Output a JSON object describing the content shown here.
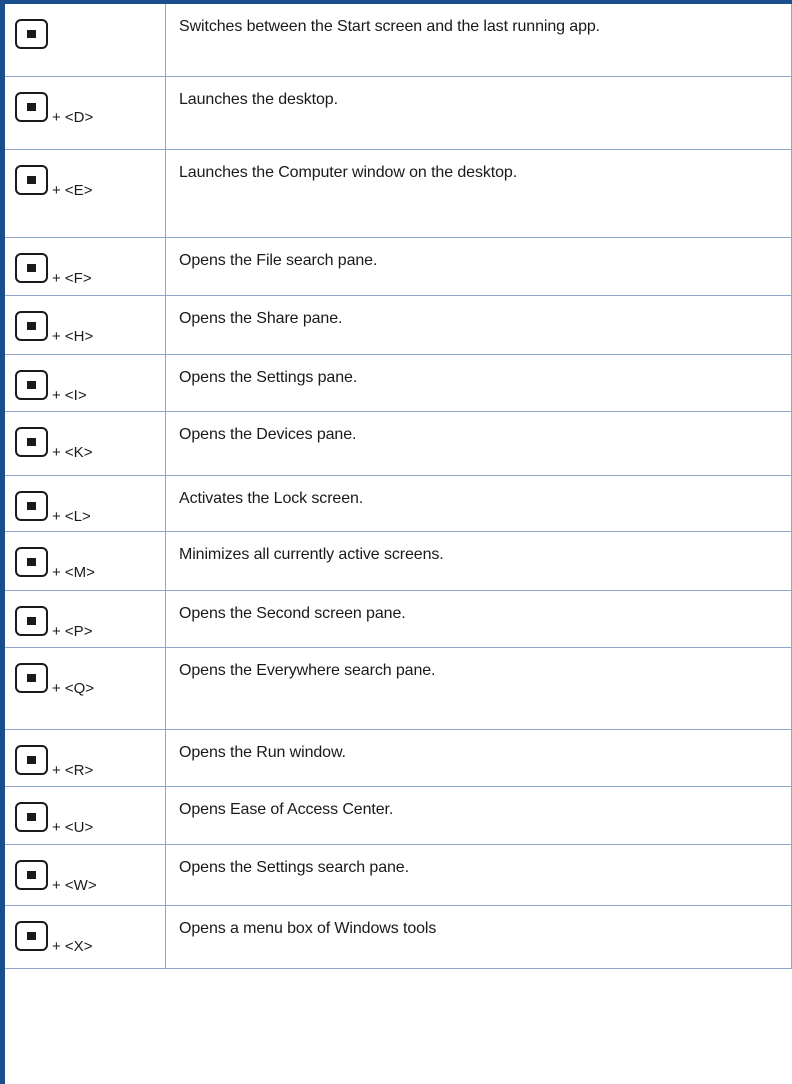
{
  "shortcuts": [
    {
      "combo": "",
      "description": "Switches between the Start screen and the last running app."
    },
    {
      "combo": "+ <D>",
      "description": "Launches the desktop."
    },
    {
      "combo": "+ <E>",
      "description": "Launches the Computer window on the desktop."
    },
    {
      "combo": "+ <F>",
      "description": "Opens the File search pane."
    },
    {
      "combo": "+ <H>",
      "description": "Opens the Share pane."
    },
    {
      "combo": "+ <I>",
      "description": "Opens the Settings pane."
    },
    {
      "combo": "+ <K>",
      "description": "Opens the Devices pane."
    },
    {
      "combo": "+ <L>",
      "description": "Activates the Lock screen."
    },
    {
      "combo": "+ <M>",
      "description": "Minimizes all currently active screens."
    },
    {
      "combo": "+ <P>",
      "description": "Opens the Second screen pane."
    },
    {
      "combo": "+ <Q>",
      "description": "Opens the Everywhere search pane."
    },
    {
      "combo": "+ <R>",
      "description": "Opens the Run window."
    },
    {
      "combo": "+ <U>",
      "description": "Opens Ease of Access Center."
    },
    {
      "combo": "+ <W>",
      "description": "Opens the Settings search pane."
    },
    {
      "combo": "+ <X>",
      "description": "Opens a menu box of Windows tools"
    }
  ],
  "colors": {
    "accent_rule": "#1b4e8c",
    "grid_line": "#8ea6c9"
  },
  "icons": {
    "windows_key": "windows-key-icon"
  }
}
